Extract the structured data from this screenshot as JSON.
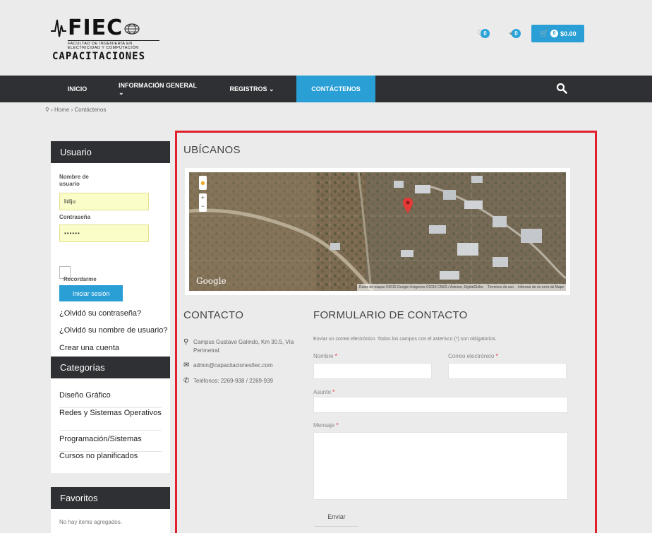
{
  "header": {
    "logo_main": "FIEC",
    "logo_sub_1": "FACULTAD DE INGENIERÍA EN",
    "logo_sub_2": "ELECTRICIDAD Y COMPUTACIÓN",
    "logo_caption": "CAPACITACIONES",
    "wishlist_count": "0",
    "compare_count": "0",
    "cart_count": "0",
    "cart_total": "$0.00"
  },
  "nav": {
    "items": [
      {
        "label": "INICIO"
      },
      {
        "label": "INFORMACIÓN GENERAL ⌄"
      },
      {
        "label": "REGISTROS ⌄"
      },
      {
        "label": "CONTÁCTENOS"
      }
    ]
  },
  "breadcrumb": {
    "home": "Home",
    "separator": "›",
    "current": "Contáctenos"
  },
  "login": {
    "title": "Usuario",
    "username_label": "Nombre de usuario",
    "username_value": "lidiju",
    "password_label": "Contraseña",
    "password_value": "••••••",
    "remember_label": "Recordarme",
    "submit_label": "Iniciar sesión",
    "links": [
      "¿Olvidó su contraseña?",
      "¿Olvidó su nombre de usuario?",
      "Crear una cuenta"
    ]
  },
  "categories": {
    "title": "Categorías",
    "items": [
      "Diseño Gráfico",
      "Redes y Sistemas Operativos",
      "Programación/Sistemas",
      "Cursos no planificados"
    ]
  },
  "favorites": {
    "title": "Favoritos",
    "empty_text": "No hay items agregados."
  },
  "locate": {
    "title": "UBÍCANOS",
    "map_brand": "Google",
    "map_attribution": "Datos de mapas ©2015 Google Imágenes ©2015 CNES / Astrium, DigitalGlobe",
    "map_terms": "Términos de uso",
    "map_report": "Informar de un error de Maps"
  },
  "contact": {
    "title": "CONTACTO",
    "address": "Campus Gustavo Galindo, Km 30.5, Vía Perimetral.",
    "email": "admin@capacitacionesfiec.com",
    "phones": "Teléfonos: 2269-938 / 2269-939"
  },
  "form": {
    "title": "FORMULARIO DE CONTACTO",
    "intro": "Enviar un correo electrónico. Todos los campos con el asterisco (*) son obligatorios.",
    "name_label": "Nombre",
    "email_label": "Correo electrónico",
    "subject_label": "Asunto",
    "message_label": "Mensaje",
    "required_mark": "*",
    "send_label": "Enviar"
  },
  "colors": {
    "accent": "#2a9fd6",
    "navbar": "#2f3033",
    "highlight_border": "#e0202a",
    "input_autofill": "#fbfdc8"
  }
}
